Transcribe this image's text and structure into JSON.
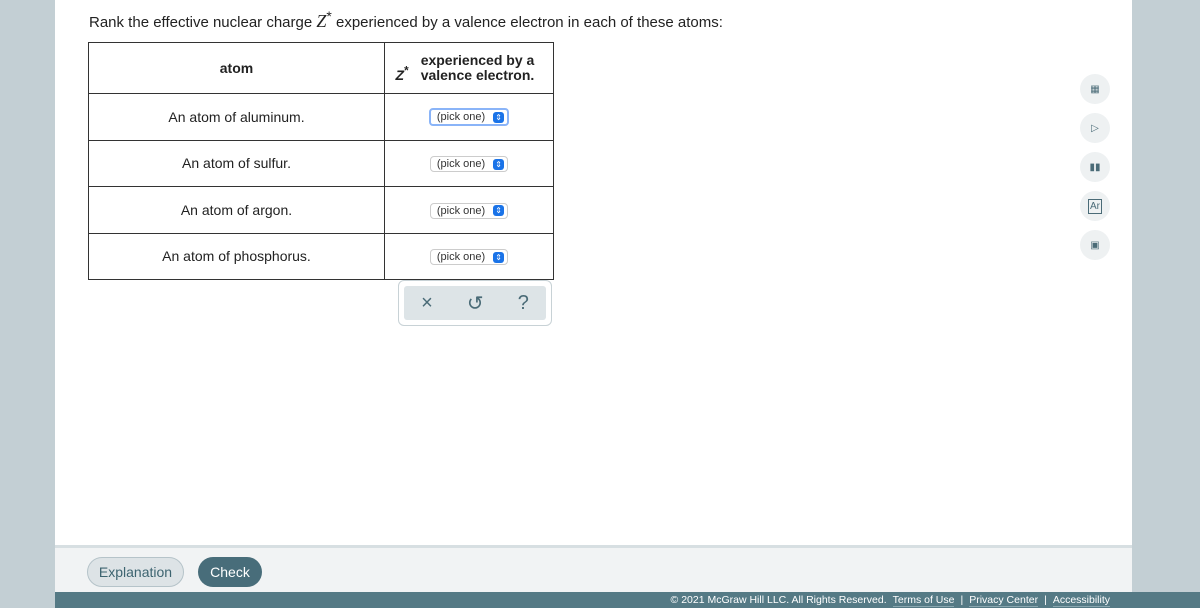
{
  "question": {
    "prefix": "Rank the effective nuclear charge ",
    "symbol": "Z",
    "sup": "*",
    "suffix": " experienced by a valence electron in each of these atoms:"
  },
  "table": {
    "headers": [
      "atom",
      "experienced by a valence electron."
    ],
    "header_symbol": "Z",
    "header_sup": "*",
    "rows": [
      {
        "atom": "An atom of aluminum.",
        "value": "(pick one)"
      },
      {
        "atom": "An atom of sulfur.",
        "value": "(pick one)"
      },
      {
        "atom": "An atom of argon.",
        "value": "(pick one)"
      },
      {
        "atom": "An atom of phosphorus.",
        "value": "(pick one)"
      }
    ]
  },
  "tools": {
    "clear": "×",
    "undo": "↺",
    "help": "?"
  },
  "sidebar": {
    "icons": [
      "calculator-icon",
      "video-icon",
      "chart-icon",
      "periodic-table-icon",
      "reference-book-icon"
    ],
    "periodic_label": "Ar"
  },
  "buttons": {
    "explanation": "Explanation",
    "check": "Check"
  },
  "footer": {
    "copyright": "© 2021 McGraw Hill LLC. All Rights Reserved.",
    "terms": "Terms of Use",
    "privacy": "Privacy Center",
    "accessibility": "Accessibility",
    "sep": "|"
  },
  "colors": {
    "accent": "#486d7a",
    "footer": "#557a85",
    "select_arrow": "#1a73e8"
  }
}
